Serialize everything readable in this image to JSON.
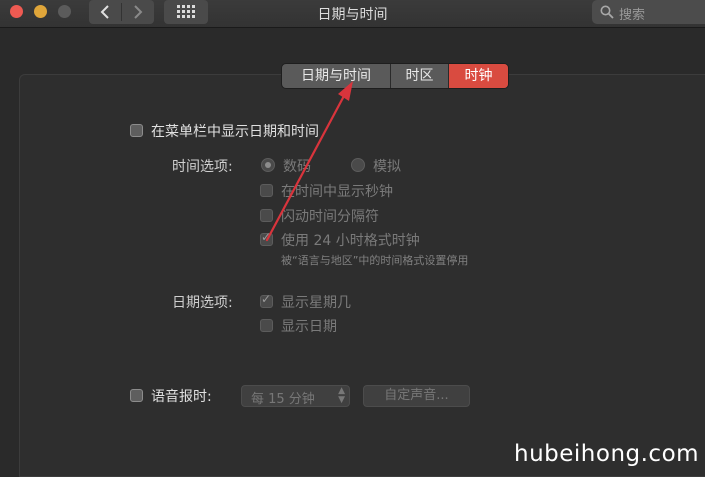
{
  "window": {
    "title": "日期与时间",
    "traffic_lights": {
      "close": "#ee5a52",
      "minimize": "#e0a63a",
      "zoom": "#5b5b5b"
    },
    "nav_back_icon": "chevron-left-icon",
    "nav_forward_icon": "chevron-right-icon",
    "grid_icon": "grid-icon",
    "search": {
      "placeholder": "搜索",
      "icon": "search-icon"
    }
  },
  "tabs": [
    {
      "label": "日期与时间",
      "active": false
    },
    {
      "label": "时区",
      "active": false
    },
    {
      "label": "时钟",
      "active": true
    }
  ],
  "accent_color": "#d94b40",
  "clock": {
    "show_in_menubar": {
      "label": "在菜单栏中显示日期和时间",
      "checked": false
    },
    "time_options": {
      "label": "时间选项:",
      "digital": {
        "label": "数码",
        "selected": true
      },
      "analog": {
        "label": "模拟",
        "selected": false
      },
      "show_seconds": {
        "label": "在时间中显示秒钟",
        "checked": false
      },
      "flash_separators": {
        "label": "闪动时间分隔符",
        "checked": false
      },
      "use_24h": {
        "label": "使用 24 小时格式时钟",
        "checked": true
      },
      "note": "被“语言与地区”中的时间格式设置停用"
    },
    "date_options": {
      "label": "日期选项:",
      "show_weekday": {
        "label": "显示星期几",
        "checked": true
      },
      "show_date": {
        "label": "显示日期",
        "checked": false
      }
    },
    "announce": {
      "label": "语音报时:",
      "checked": false,
      "interval": "每 15 分钟",
      "customize_button": "自定声音..."
    }
  },
  "annotation_arrow_color": "#d9343c",
  "watermark": "hubeihong.com"
}
